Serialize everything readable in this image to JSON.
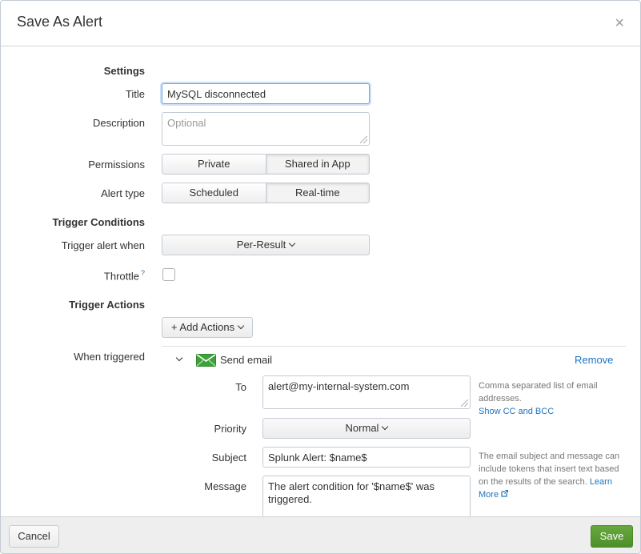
{
  "dialog": {
    "title": "Save As Alert",
    "close_glyph": "×"
  },
  "sections": {
    "settings": "Settings",
    "trigger_conditions": "Trigger Conditions",
    "trigger_actions": "Trigger Actions"
  },
  "fields": {
    "title": {
      "label": "Title",
      "value": "MySQL disconnected"
    },
    "description": {
      "label": "Description",
      "placeholder": "Optional"
    },
    "permissions": {
      "label": "Permissions",
      "options": [
        "Private",
        "Shared in App"
      ],
      "selected": "Shared in App"
    },
    "alert_type": {
      "label": "Alert type",
      "options": [
        "Scheduled",
        "Real-time"
      ],
      "selected": "Real-time"
    },
    "trigger_alert_when": {
      "label": "Trigger alert when",
      "value": "Per-Result"
    },
    "throttle": {
      "label": "Throttle",
      "help_mark": "?",
      "checked": false
    }
  },
  "actions": {
    "add_label": "+ Add Actions",
    "when_triggered_label": "When triggered",
    "email": {
      "name": "Send email",
      "remove_label": "Remove",
      "icon": "envelope-icon",
      "icon_color": "#3ea23a",
      "to": {
        "label": "To",
        "value": "alert@my-internal-system.com"
      },
      "to_help": {
        "line1": "Comma separated list of email",
        "line2": "addresses.",
        "link": "Show CC and BCC"
      },
      "priority": {
        "label": "Priority",
        "value": "Normal"
      },
      "subject": {
        "label": "Subject",
        "value": "Splunk Alert: $name$"
      },
      "subject_help": {
        "line1": "The email subject and message can",
        "line2": "include tokens that insert text based",
        "line3": "on the results of the search.",
        "link1": "Learn",
        "link2": "More"
      },
      "message": {
        "label": "Message",
        "line1": "The alert condition for '$name$' was",
        "line2": "triggered."
      }
    }
  },
  "footer": {
    "cancel_label": "Cancel",
    "save_label": "Save"
  },
  "colors": {
    "accent_link": "#1e73be",
    "save_green": "#5a9c33"
  }
}
